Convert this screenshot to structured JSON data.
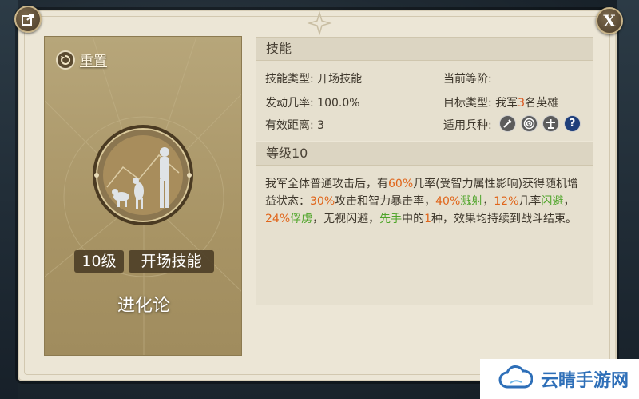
{
  "buttons": {
    "share_icon": "share-icon",
    "close_label": "X"
  },
  "left_card": {
    "reset_label": "重置",
    "level_tag": "10级",
    "type_tag": "开场技能",
    "skill_name": "进化论"
  },
  "skill_section": {
    "header": "技能",
    "skill_type_label": "技能类型:",
    "skill_type_value": "开场技能",
    "current_tier_label": "当前等阶:",
    "trigger_rate_label": "发动几率:",
    "trigger_rate_value": "100.0%",
    "target_type_label": "目标类型:",
    "target_type_prefix": "我军",
    "target_type_count": "3",
    "target_type_suffix": "名英雄",
    "range_label": "有效距离:",
    "range_value": "3",
    "unit_types_label": "适用兵种:",
    "unit_icons": [
      "sword-icon",
      "target-icon",
      "crossbow-icon",
      "question-icon"
    ]
  },
  "level_section": {
    "header": "等级10",
    "desc": [
      {
        "t": "我军全体普通攻击后，有",
        "c": ""
      },
      {
        "t": "60%",
        "c": "orange"
      },
      {
        "t": "几率(受智力属性影响)获得随机增益状态：",
        "c": ""
      },
      {
        "t": "30%",
        "c": "orange"
      },
      {
        "t": "攻击和智力暴击率，",
        "c": ""
      },
      {
        "t": "40%",
        "c": "orange"
      },
      {
        "t": "溅射",
        "c": "green"
      },
      {
        "t": "，",
        "c": ""
      },
      {
        "t": "12%",
        "c": "orange"
      },
      {
        "t": "几率",
        "c": ""
      },
      {
        "t": "闪避",
        "c": "green"
      },
      {
        "t": "，",
        "c": ""
      },
      {
        "t": "24%",
        "c": "orange"
      },
      {
        "t": "俘虏",
        "c": "green"
      },
      {
        "t": "，无视闪避，",
        "c": ""
      },
      {
        "t": "先手",
        "c": "green"
      },
      {
        "t": "中的",
        "c": ""
      },
      {
        "t": "1",
        "c": "orange"
      },
      {
        "t": "种，效果均持续到战斗结束。",
        "c": ""
      }
    ]
  },
  "watermark": {
    "text": "云睛手游网"
  },
  "colors": {
    "highlight_orange": "#e0651a",
    "highlight_green": "#4fa52a",
    "card_gold": "#a89465",
    "panel_bg": "#ece6d6"
  }
}
